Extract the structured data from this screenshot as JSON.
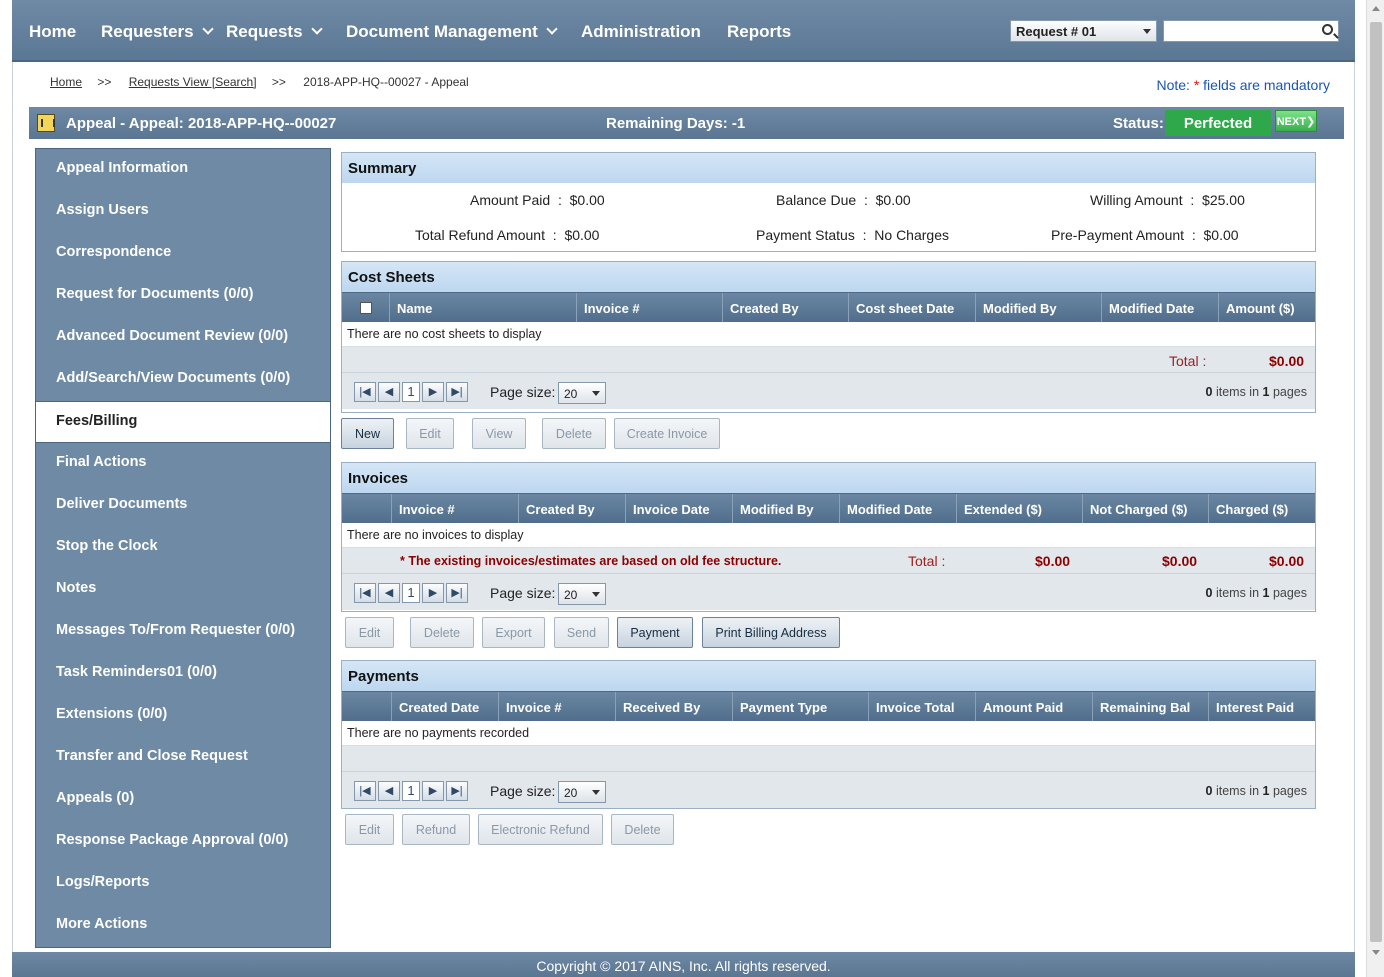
{
  "nav": {
    "home": "Home",
    "requesters": "Requesters",
    "requests": "Requests",
    "document_management": "Document Management",
    "administration": "Administration",
    "reports": "Reports",
    "request_select": "Request # 01",
    "search_value": ""
  },
  "breadcrumb": {
    "home": "Home",
    "sep": ">>",
    "requests_view": "Requests View [Search]",
    "current": "2018-APP-HQ--00027 - Appeal"
  },
  "note": {
    "prefix": "Note: ",
    "star": "*",
    "suffix": " fields are mandatory"
  },
  "titlebar": {
    "title": "Appeal - Appeal: 2018-APP-HQ--00027",
    "remaining": "Remaining Days: -1",
    "status_label": "Status:",
    "status_value": "Perfected",
    "next_label": "NEXT",
    "next_arrow": "❯"
  },
  "sidebar": {
    "items": [
      "Appeal Information",
      "Assign Users",
      "Correspondence",
      "Request for Documents (0/0)",
      "Advanced Document Review (0/0)",
      "Add/Search/View Documents (0/0)",
      "Fees/Billing",
      "Final Actions",
      "Deliver Documents",
      "Stop the Clock",
      "Notes",
      "Messages To/From Requester (0/0)",
      "Task Reminders01 (0/0)",
      "Extensions (0/0)",
      "Transfer and Close Request",
      "Appeals (0)",
      "Response Package Approval (0/0)",
      "Logs/Reports",
      "More Actions"
    ],
    "active": "Fees/Billing"
  },
  "summary": {
    "title": "Summary",
    "amount_paid_label": "Amount Paid",
    "amount_paid": "$0.00",
    "balance_due_label": "Balance Due",
    "balance_due": "$0.00",
    "willing_amount_label": "Willing Amount",
    "willing_amount": "$25.00",
    "total_refund_label": "Total Refund Amount",
    "total_refund": "$0.00",
    "payment_status_label": "Payment Status",
    "payment_status": "No Charges",
    "prepayment_label": "Pre-Payment Amount",
    "prepayment": "$0.00",
    "colon": ":"
  },
  "cost_sheets": {
    "title": "Cost Sheets",
    "columns": [
      "Name",
      "Invoice #",
      "Created By",
      "Cost sheet Date",
      "Modified By",
      "Modified Date",
      "Amount ($)"
    ],
    "empty": "There are no cost sheets to display",
    "total_label": "Total :",
    "total": "$0.00",
    "page_size_label": "Page size:",
    "page_size": "20",
    "page": "1",
    "items": "0",
    "items_mid": " items in ",
    "pages": "1",
    "pages_suffix": " pages",
    "buttons": [
      "New",
      "Edit",
      "View",
      "Delete",
      "Create Invoice"
    ]
  },
  "invoices": {
    "title": "Invoices",
    "columns": [
      "Invoice #",
      "Created By",
      "Invoice Date",
      "Modified By",
      "Modified Date",
      "Extended ($)",
      "Not Charged ($)",
      "Charged ($)"
    ],
    "empty": "There are no invoices to display",
    "warning": "* The existing invoices/estimates are based on old fee structure.",
    "total_label": "Total :",
    "extended_total": "$0.00",
    "not_charged_total": "$0.00",
    "charged_total": "$0.00",
    "page_size_label": "Page size:",
    "page_size": "20",
    "page": "1",
    "items": "0",
    "items_mid": " items in ",
    "pages": "1",
    "pages_suffix": " pages",
    "buttons": [
      "Edit",
      "Delete",
      "Export",
      "Send",
      "Payment",
      "Print Billing Address"
    ]
  },
  "payments": {
    "title": "Payments",
    "columns": [
      "Created Date",
      "Invoice #",
      "Received By",
      "Payment Type",
      "Invoice Total",
      "Amount Paid",
      "Remaining Bal",
      "Interest Paid"
    ],
    "empty": "There are no payments recorded",
    "page_size_label": "Page size:",
    "page_size": "20",
    "page": "1",
    "items": "0",
    "items_mid": " items in ",
    "pages": "1",
    "pages_suffix": " pages",
    "buttons": [
      "Edit",
      "Refund",
      "Electronic Refund",
      "Delete"
    ]
  },
  "pager_icons": {
    "first": "first-page-icon",
    "prev": "prev-page-icon",
    "next": "next-page-icon",
    "last": "last-page-icon"
  },
  "footer": "Copyright © 2017 AINS, Inc. All rights reserved.",
  "colors": {
    "nav_bg": "#5a7794",
    "status_green": "#2ea84a",
    "panel_head": "#bdd7f0",
    "total_red": "#8b0000"
  }
}
